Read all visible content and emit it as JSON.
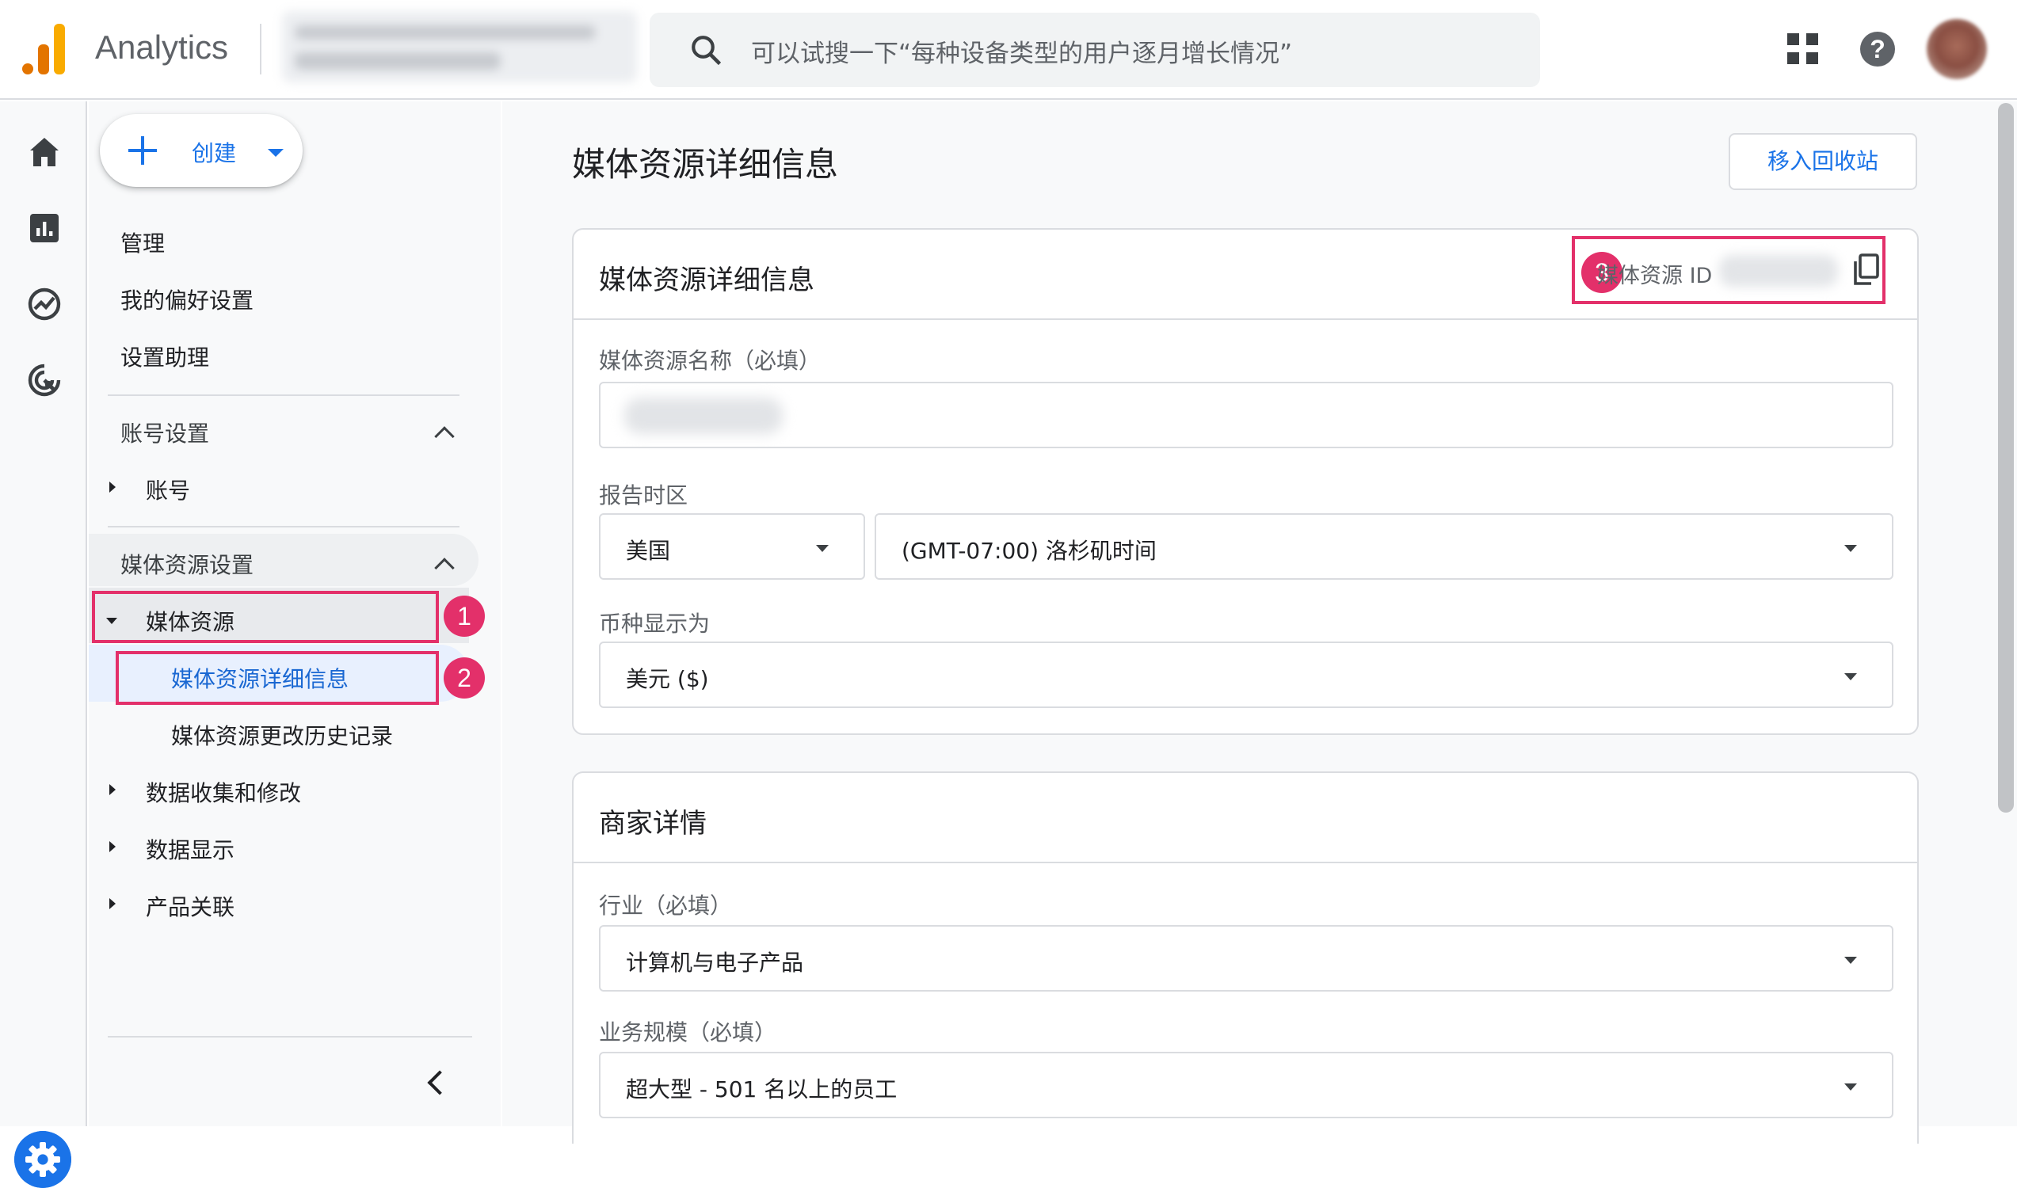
{
  "app": {
    "name": "Analytics"
  },
  "search": {
    "placeholder": "可以试搜一下“每种设备类型的用户逐月增长情况”"
  },
  "nav": {
    "create_label": "创建",
    "items": [
      "管理",
      "我的偏好设置",
      "设置助理"
    ],
    "account_section": "账号设置",
    "account_item": "账号",
    "property_section": "媒体资源设置",
    "property_item": "媒体资源",
    "property_children": [
      "媒体资源详细信息",
      "媒体资源更改历史记录"
    ],
    "other_items": [
      "数据收集和修改",
      "数据显示",
      "产品关联"
    ]
  },
  "badges": [
    "1",
    "2",
    "3"
  ],
  "main": {
    "page_title": "媒体资源详细信息",
    "trash_button": "移入回收站",
    "details_card": {
      "title": "媒体资源详细信息",
      "property_id_label": "媒体资源 ID",
      "name_label": "媒体资源名称（必填）",
      "timezone_label": "报告时区",
      "country": "美国",
      "timezone": "(GMT-07:00) 洛杉矶时间",
      "currency_label": "币种显示为",
      "currency": "美元 ($)"
    },
    "business_card": {
      "title": "商家详情",
      "industry_label": "行业（必填）",
      "industry": "计算机与电子产品",
      "size_label": "业务规模（必填）",
      "size": "超大型 - 501 名以上的员工"
    }
  },
  "colors": {
    "accent": "#1a73e8",
    "highlight": "#e3306a",
    "logo_orange": "#f9ab00",
    "logo_dark": "#e37400"
  },
  "icons": [
    "analytics-logo-icon",
    "search-icon",
    "apps-icon",
    "help-icon",
    "home-icon",
    "reports-icon",
    "explore-icon",
    "advertising-icon",
    "settings-gear-icon",
    "copy-icon",
    "chevron-up-icon",
    "collapse-chevron-icon"
  ]
}
